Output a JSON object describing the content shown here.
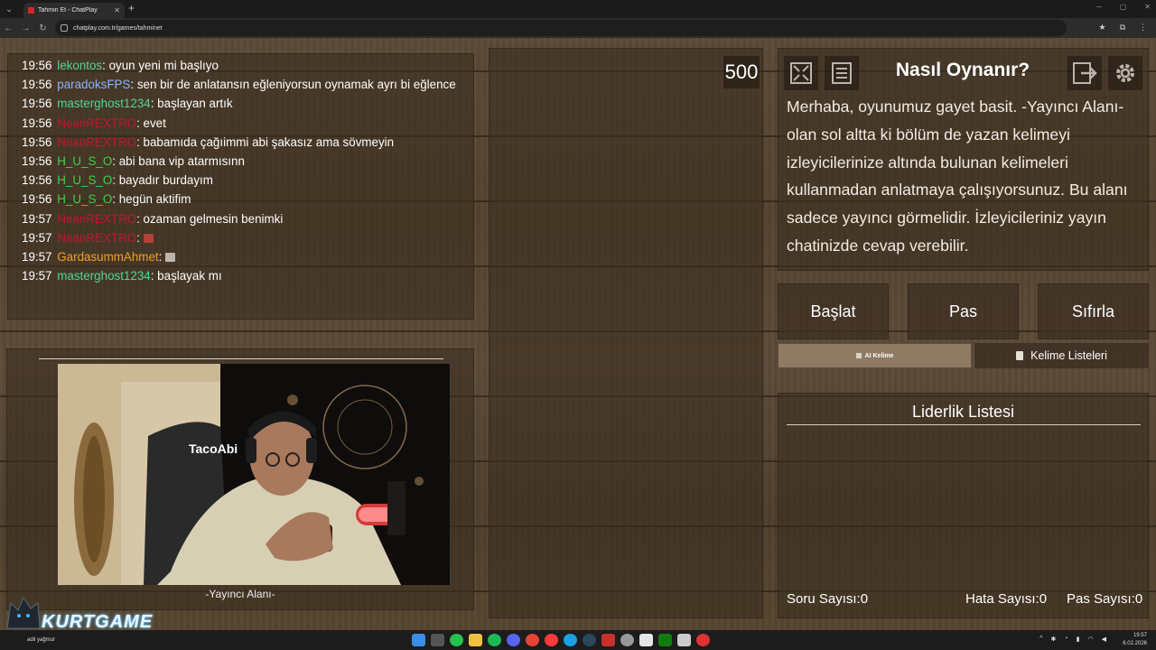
{
  "browser": {
    "tab_title": "Tahmin Et - ChatPlay",
    "tab_close": "✕",
    "new_tab": "+",
    "url": "chatplay.com.tr/games/tahminet",
    "window_controls": [
      "─",
      "▢",
      "✕"
    ]
  },
  "chat": {
    "messages": [
      {
        "time": "19:56",
        "user": "lekontos",
        "color": "#4fd49a",
        "text": ": oyun yeni mi başlıyo"
      },
      {
        "time": "19:56",
        "user": "paradoksFPS",
        "color": "#8ab4ff",
        "text": ": sen bir de anlatansın eğleniyorsun oynamak ayrı bi eğlence"
      },
      {
        "time": "19:56",
        "user": "masterghost1234",
        "color": "#4fd49a",
        "text": ": başlayan artık"
      },
      {
        "time": "19:56",
        "user": "NeanREXTRO",
        "color": "#c0162f",
        "text": ": evet"
      },
      {
        "time": "19:56",
        "user": "NeanREXTRO",
        "color": "#c0162f",
        "text": ": babamıda çağıimmi abi şakasız ama sövmeyin"
      },
      {
        "time": "19:56",
        "user": "H_U_S_O",
        "color": "#3fd24a",
        "text": ": abi bana vip atarmısınn"
      },
      {
        "time": "19:56",
        "user": "H_U_S_O",
        "color": "#3fd24a",
        "text": ": bayadır burdayım"
      },
      {
        "time": "19:56",
        "user": "H_U_S_O",
        "color": "#3fd24a",
        "text": ": hegün aktifim"
      },
      {
        "time": "19:57",
        "user": "NeanREXTRO",
        "color": "#c0162f",
        "text": ": ozaman gelmesin benimki"
      },
      {
        "time": "19:57",
        "user": "NeanREXTRO",
        "color": "#c0162f",
        "text": ": "
      },
      {
        "time": "19:57",
        "user": "GardasummAhmet",
        "color": "#f0a12a",
        "text": ": "
      },
      {
        "time": "19:57",
        "user": "masterghost1234",
        "color": "#4fd49a",
        "text": ": başlayak mı"
      }
    ]
  },
  "score": "500",
  "webcam": {
    "label": "-Yayıncı Alanı-",
    "chair_text": "TacoAbi"
  },
  "rules": {
    "title": "Nasıl Oynanır?",
    "text": "Merhaba, oyunumuz gayet basit. -Yayıncı Alanı- olan sol altta ki bölüm de yazan kelimeyi izleyicilerinize altında bulunan kelimeleri kullanmadan anlatmaya çalışıyorsunuz. Bu alanı sadece yayıncı görmelidir. İzleyicileriniz yayın chatinizde cevap verebilir."
  },
  "buttons": {
    "start": "Başlat",
    "pass": "Pas",
    "reset": "Sıfırla",
    "ai_word": "AI Kelime",
    "word_lists": "Kelime Listeleri"
  },
  "leaderboard": {
    "title": "Liderlik Listesi",
    "question_count": "Soru Sayısı:0",
    "error_count": "Hata Sayısı:0",
    "pass_count": "Pas Sayısı:0"
  },
  "logo": {
    "text": "KURTGAME"
  },
  "taskbar": {
    "user_label": "adil yağmur",
    "time": "19:57",
    "date": "6.02.2026",
    "tray_arrow": "^"
  }
}
